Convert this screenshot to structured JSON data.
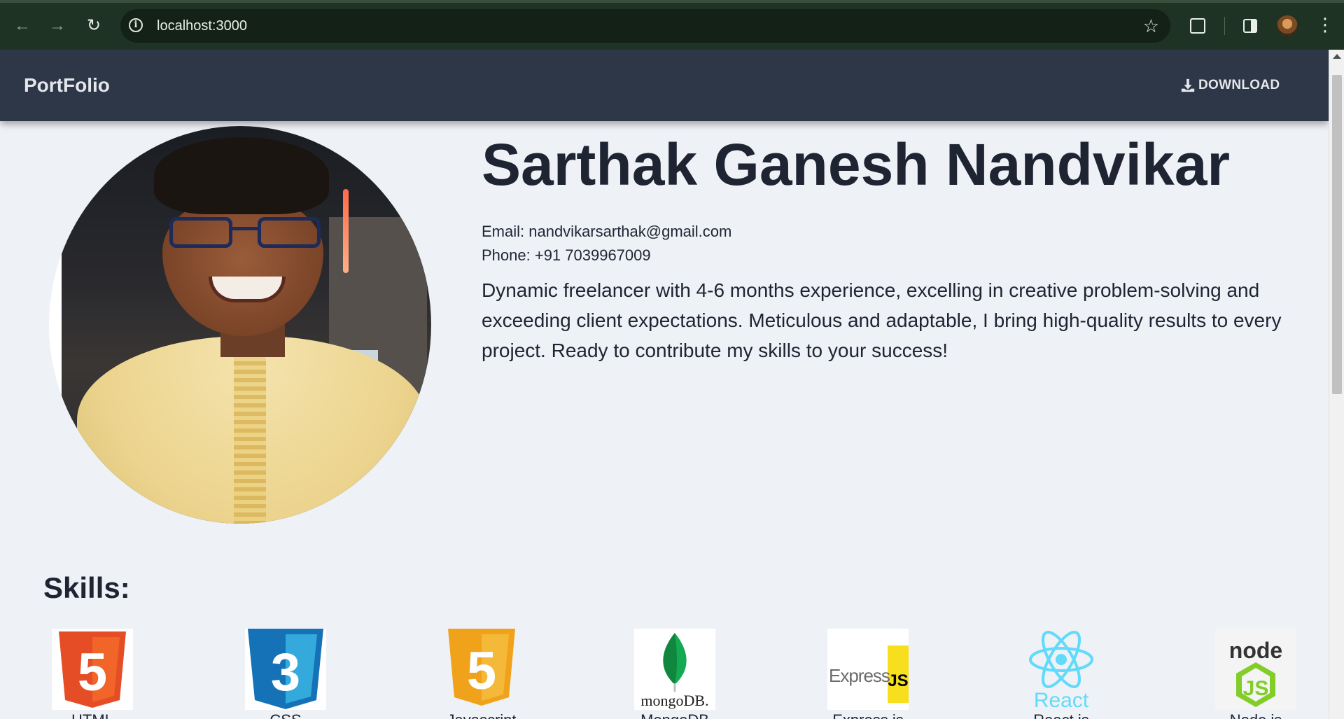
{
  "browser": {
    "url": "localhost:3000",
    "back_icon": "arrow-left-icon",
    "forward_icon": "arrow-right-icon",
    "reload_icon": "reload-icon",
    "bookmark_icon": "star-icon",
    "menu_icon": "kebab-menu-icon"
  },
  "navbar": {
    "brand": "PortFolio",
    "download_label": "DOWNLOAD",
    "bg_color": "#2d3748"
  },
  "hero": {
    "name": "Sarthak Ganesh Nandvikar",
    "email_line": "Email: nandvikarsarthak@gmail.com",
    "phone_line": "Phone: +91 7039967009",
    "bio": "Dynamic freelancer with 4-6 months experience, excelling in creative problem-solving and exceeding client expectations. Meticulous and adaptable, I bring high-quality results to every project. Ready to contribute my skills to your success!"
  },
  "skills": {
    "title": "Skills:",
    "items": [
      {
        "label": "HTML",
        "logo": "html5-logo",
        "logo_text": "5",
        "color": "#e44d26"
      },
      {
        "label": "CSS",
        "logo": "css3-logo",
        "logo_text": "3",
        "color": "#1572b6"
      },
      {
        "label": "Javascript",
        "logo": "javascript-logo",
        "logo_text": "5",
        "color": "#f0a21a"
      },
      {
        "label": "MongoDB",
        "logo": "mongodb-logo",
        "logo_text": "mongoDB.",
        "color": "#13aa52"
      },
      {
        "label": "Express.js",
        "logo": "express-js-logo",
        "logo_text": "Express",
        "logo_badge": "JS",
        "color": "#f7df1e"
      },
      {
        "label": "React.js",
        "logo": "react-logo",
        "logo_text": "React",
        "color": "#61dafb"
      },
      {
        "label": "Node.js",
        "logo": "nodejs-logo",
        "logo_text": "node",
        "logo_badge": "JS",
        "color": "#83cd29"
      }
    ]
  }
}
